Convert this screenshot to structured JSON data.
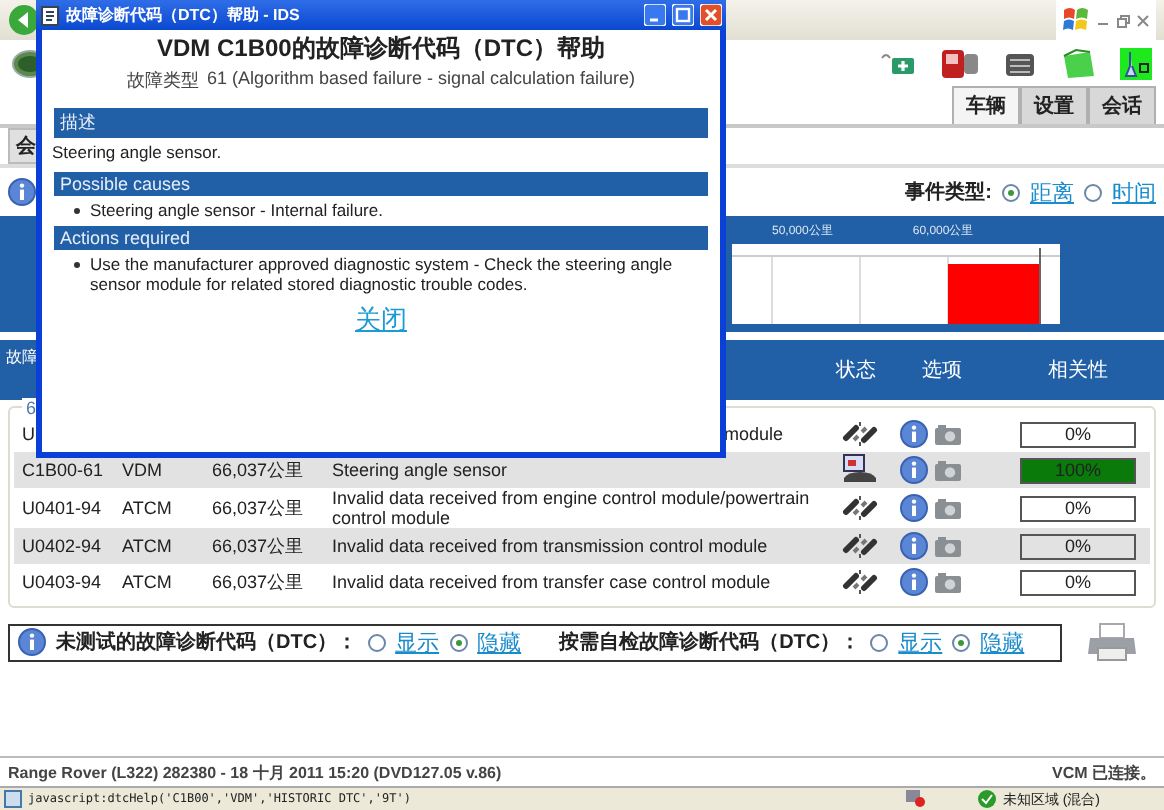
{
  "browser": {
    "status_url": "javascript:dtcHelp('C1B00','VDM','HISTORIC DTC','9T')",
    "zone": "未知区域 (混合)"
  },
  "tabs": [
    {
      "label": "车辆",
      "selected": true
    },
    {
      "label": "设置",
      "selected": false
    },
    {
      "label": "会话",
      "selected": false
    }
  ],
  "subtab": {
    "label": "会"
  },
  "event_type": {
    "label": "事件类型:",
    "options": [
      {
        "label": "距离",
        "selected": true
      },
      {
        "label": "时间",
        "selected": false
      }
    ]
  },
  "timeline": {
    "labels": [
      "50,000公里",
      "60,000公里"
    ]
  },
  "table": {
    "columns": [
      {
        "label": "故障"
      },
      {
        "label": "状态"
      },
      {
        "label": "选项"
      },
      {
        "label": "相关性"
      }
    ],
    "group_label": "6",
    "rows": [
      {
        "code": "U",
        "description": "module",
        "kind": "chain",
        "relevance": "0%"
      },
      {
        "code": "C1B00-61",
        "module": "VDM",
        "mileage": "66,037公里",
        "description": "Steering angle sensor",
        "kind": "screen",
        "relevance": "100%",
        "level": 1
      },
      {
        "code": "U0401-94",
        "module": "ATCM",
        "mileage": "66,037公里",
        "description": "Invalid data received from engine control module/powertrain control module",
        "kind": "chain",
        "relevance": "0%"
      },
      {
        "code": "U0402-94",
        "module": "ATCM",
        "mileage": "66,037公里",
        "description": "Invalid data received from transmission control module",
        "kind": "chain",
        "relevance": "0%"
      },
      {
        "code": "U0403-94",
        "module": "ATCM",
        "mileage": "66,037公里",
        "description": "Invalid data received from transfer case control module",
        "kind": "chain",
        "relevance": "0%"
      }
    ]
  },
  "legend": [
    {
      "label": "未测试的故障诊断代码（DTC）：",
      "options": [
        {
          "label": "显示",
          "selected": false
        },
        {
          "label": "隐藏",
          "selected": true
        }
      ]
    },
    {
      "label": "按需自检故障诊断代码（DTC）：",
      "options": [
        {
          "label": "显示",
          "selected": false
        },
        {
          "label": "隐藏",
          "selected": true
        }
      ]
    }
  ],
  "footer": {
    "vehicle": "Range Rover (L322) 282380 - 18 十月  2011 15:20 (DVD127.05 v.86)",
    "connection": "VCM 已连接。"
  },
  "dialog": {
    "title": "故障诊断代码（DTC）帮助 - IDS",
    "heading": "VDM C1B00的故障诊断代码（DTC）帮助",
    "fault_type_label": "故障类型",
    "fault_type": "61 (Algorithm based failure - signal calculation failure)",
    "sections": [
      {
        "title": "描述",
        "kind": "text",
        "text": "Steering angle sensor."
      },
      {
        "title": "Possible causes",
        "kind": "list",
        "items": [
          "Steering angle sensor - Internal failure."
        ]
      },
      {
        "title": "Actions required",
        "kind": "list",
        "items": [
          "Use the manufacturer approved diagnostic system - Check the steering angle sensor module for related stored diagnostic trouble codes."
        ]
      }
    ],
    "close_link": "关闭"
  }
}
